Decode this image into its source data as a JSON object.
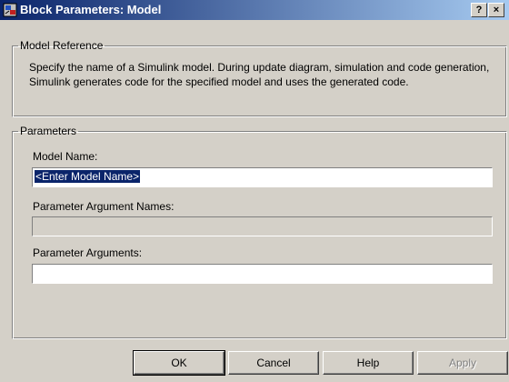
{
  "window": {
    "title": "Block Parameters: Model",
    "help_glyph": "?",
    "close_glyph": "×"
  },
  "model_reference": {
    "legend": "Model Reference",
    "description": "Specify the name of a Simulink model. During update diagram, simulation and code generation, Simulink generates code for the specified model and uses the generated code."
  },
  "parameters": {
    "legend": "Parameters",
    "model_name_label": "Model Name:",
    "model_name_value": "<Enter Model Name>",
    "arg_names_label": "Parameter Argument Names:",
    "arg_names_value": "",
    "args_label": "Parameter Arguments:",
    "args_value": ""
  },
  "buttons": {
    "ok": "OK",
    "cancel": "Cancel",
    "help": "Help",
    "apply": "Apply"
  },
  "icons": [
    "simulink-block-icon",
    "help-icon",
    "close-icon"
  ]
}
